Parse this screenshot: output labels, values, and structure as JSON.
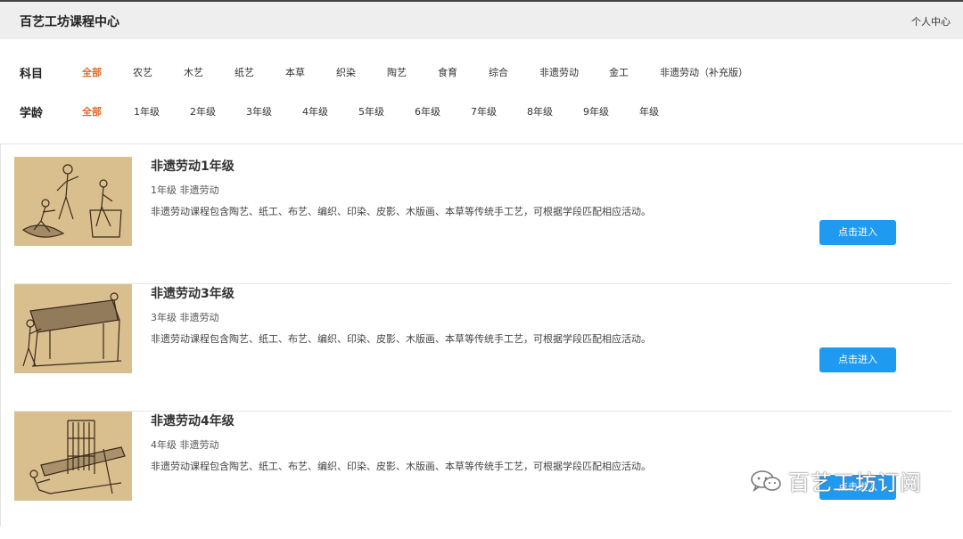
{
  "header": {
    "title": "百艺工坊课程中心",
    "user_center": "个人中心"
  },
  "filters": {
    "subject_label": "科目",
    "subjects": [
      "全部",
      "农艺",
      "木艺",
      "纸艺",
      "本草",
      "织染",
      "陶艺",
      "食育",
      "综合",
      "非遗劳动",
      "金工",
      "非遗劳动（补充版）"
    ],
    "age_label": "学龄",
    "ages": [
      "全部",
      "1年级",
      "2年级",
      "3年级",
      "4年级",
      "5年级",
      "6年级",
      "7年级",
      "8年级",
      "9年级",
      "年级"
    ],
    "active_color": "#e06a2b"
  },
  "courses": [
    {
      "title": "非遗劳动1年级",
      "meta": "1年级 非遗劳动",
      "desc": "非遗劳动课程包含陶艺、纸工、布艺、编织、印染、皮影、木版画、本草等传统手工艺，可根据学段匹配相应活动。",
      "button": "点击进入"
    },
    {
      "title": "非遗劳动3年级",
      "meta": "3年级 非遗劳动",
      "desc": "非遗劳动课程包含陶艺、纸工、布艺、编织、印染、皮影、木版画、本草等传统手工艺，可根据学段匹配相应活动。",
      "button": "点击进入"
    },
    {
      "title": "非遗劳动4年级",
      "meta": "4年级 非遗劳动",
      "desc": "非遗劳动课程包含陶艺、纸工、布艺、编织、印染、皮影、木版画、本草等传统手工艺，可根据学段匹配相应活动。",
      "button": "点击进入"
    }
  ],
  "watermark": {
    "text": "百艺工坊订阅",
    "icon": "wechat-icon"
  },
  "colors": {
    "accent": "#1e9bf0",
    "header_bg": "#eeeeee"
  }
}
